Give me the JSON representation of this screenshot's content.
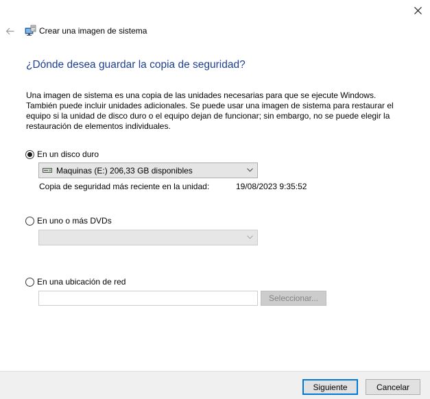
{
  "window": {
    "title": "Crear una imagen de sistema",
    "close_icon": "close-icon",
    "back_icon": "back-arrow-icon",
    "app_icon": "system-image-backup-icon"
  },
  "main": {
    "heading": "¿Dónde desea guardar la copia de seguridad?",
    "description": "Una imagen de sistema es una copia de las unidades necesarias para que se ejecute Windows. También puede incluir unidades adicionales. Se puede usar una imagen de sistema para restaurar el equipo si la unidad de disco duro o el equipo dejan de funcionar; sin embargo, no se puede elegir la restauración de elementos individuales."
  },
  "options": {
    "hard_disk": {
      "label": "En un disco duro",
      "selected": true,
      "drive_value": "Maquinas (E:)  206,33 GB disponibles",
      "recent_backup_label": "Copia de seguridad más reciente en la unidad:",
      "recent_backup_value": "19/08/2023 9:35:52"
    },
    "dvd": {
      "label": "En uno o más DVDs",
      "selected": false,
      "drive_value": ""
    },
    "network": {
      "label": "En una ubicación de red",
      "selected": false,
      "path_value": "",
      "select_button": "Seleccionar..."
    }
  },
  "footer": {
    "next_button": "Siguiente",
    "cancel_button": "Cancelar"
  },
  "colors": {
    "heading": "#1c3f94",
    "accent": "#0078d7",
    "footer_bg": "#f0f0f0"
  }
}
